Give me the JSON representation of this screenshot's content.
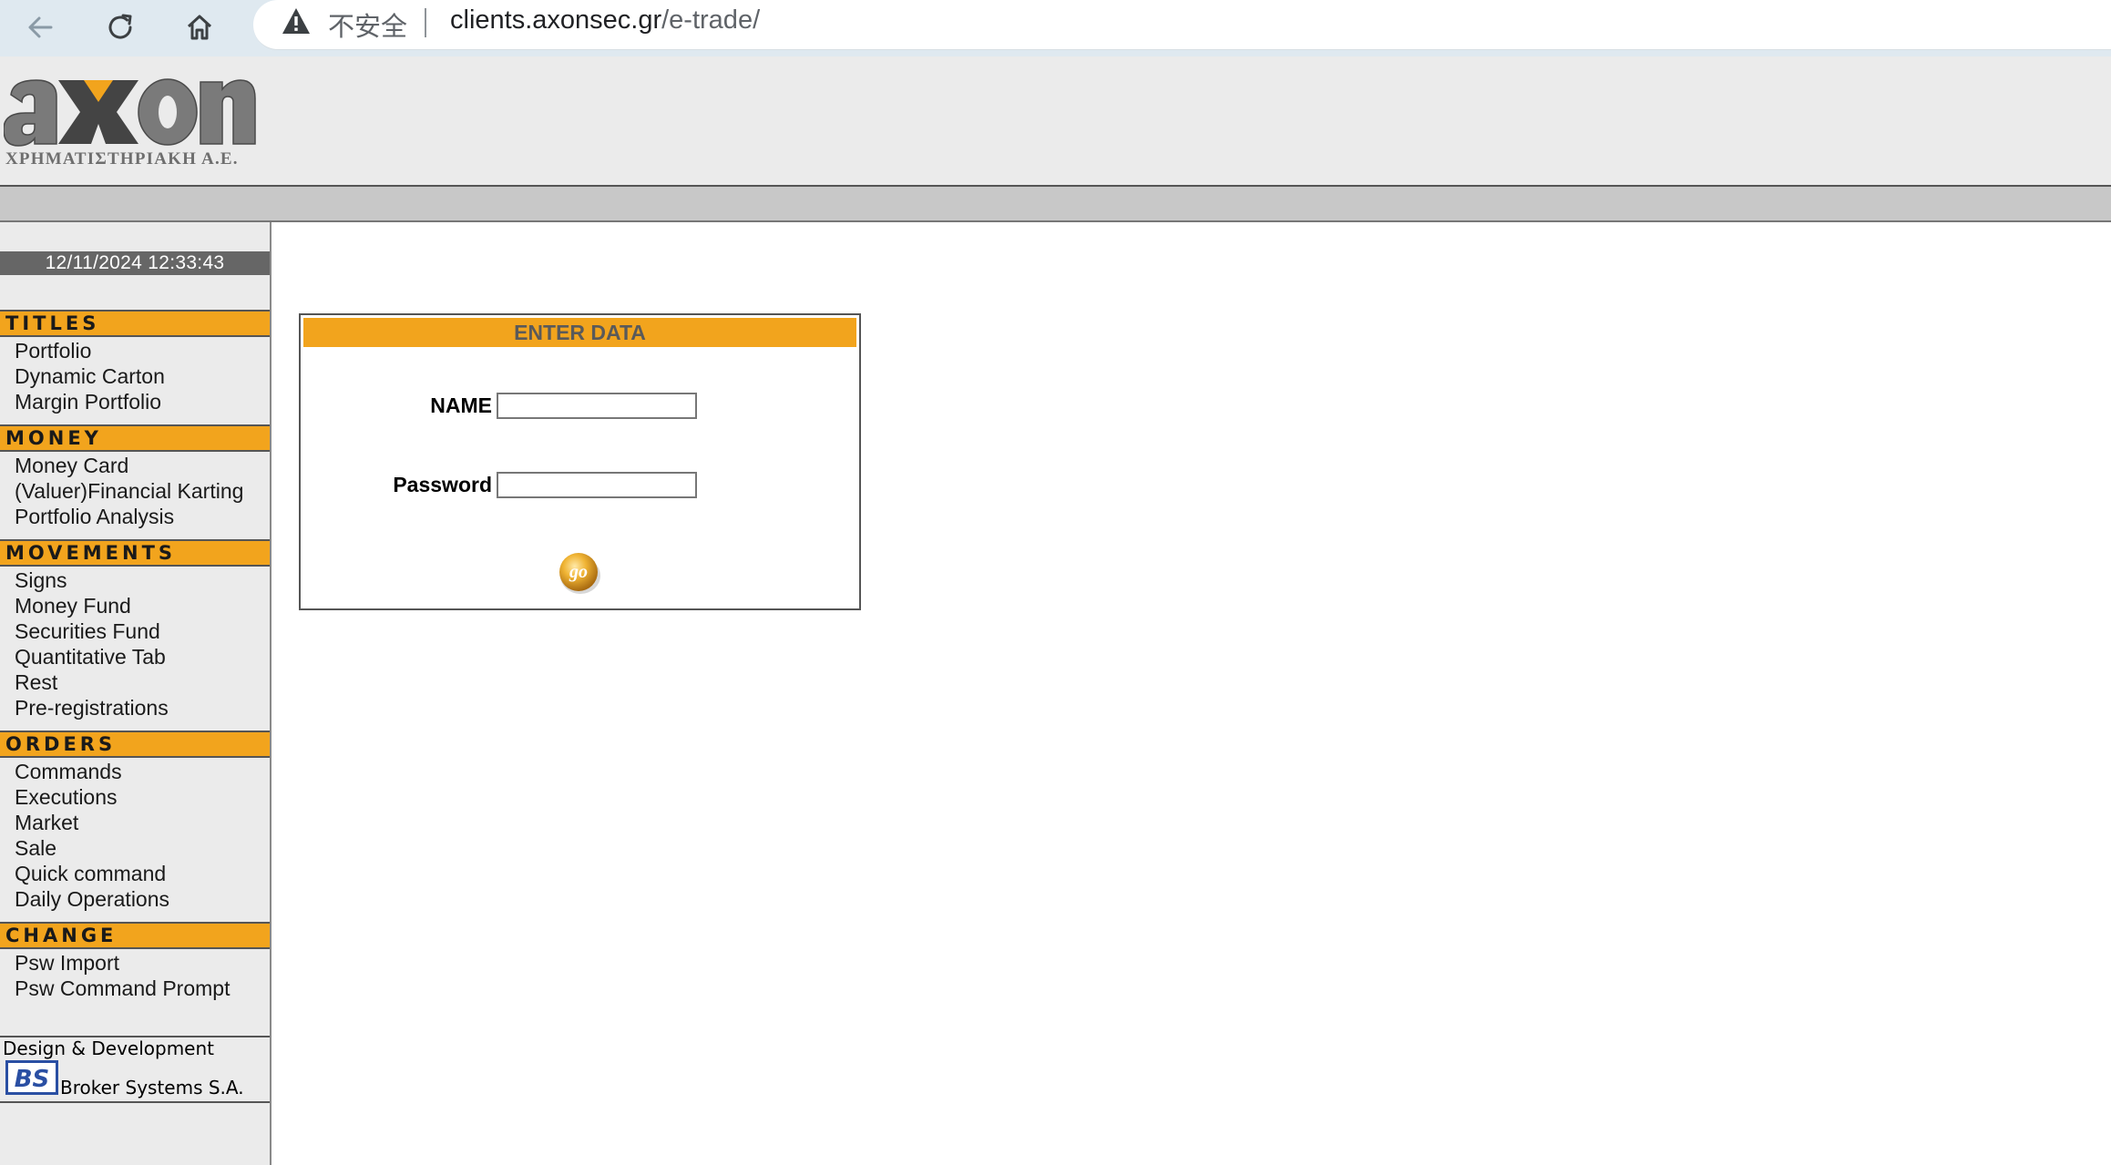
{
  "browser": {
    "security_label": "不安全",
    "url_host": "clients.axonsec.gr",
    "url_path": "/e-trade/"
  },
  "header": {
    "logo_text": "axon",
    "logo_subtitle": "ΧΡΗΜΑΤΙΣΤΗΡΙΑΚΗ Α.Ε."
  },
  "sidebar": {
    "datetime": "12/11/2024  12:33:43",
    "sections": [
      {
        "title": "TITLES",
        "items": [
          "Portfolio",
          "Dynamic Carton",
          "Margin Portfolio"
        ]
      },
      {
        "title": "MONEY",
        "items": [
          "Money Card",
          "(Valuer)Financial Karting",
          "Portfolio Analysis"
        ]
      },
      {
        "title": "MOVEMENTS",
        "items": [
          "Signs",
          "Money Fund",
          "Securities Fund",
          "Quantitative Tab",
          "Rest",
          "Pre-registrations"
        ]
      },
      {
        "title": "ORDERS",
        "items": [
          "Commands",
          "Executions",
          "Market",
          "Sale",
          "Quick command",
          "Daily Operations"
        ]
      },
      {
        "title": "CHANGE",
        "items": [
          "Psw Import",
          "Psw Command Prompt"
        ]
      }
    ],
    "footer": {
      "design_label": "Design & Development",
      "bs_logo_text": "BS",
      "company": "Broker Systems S.A."
    }
  },
  "login": {
    "title": "ENTER DATA",
    "name_label": "NAME",
    "name_value": "",
    "password_label": "Password",
    "password_value": "",
    "go_label": "go"
  },
  "colors": {
    "accent_orange": "#f2a41d",
    "header_bg": "#ebebeb",
    "band_grey": "#c8c8c8",
    "datetime_bg": "#666666"
  }
}
